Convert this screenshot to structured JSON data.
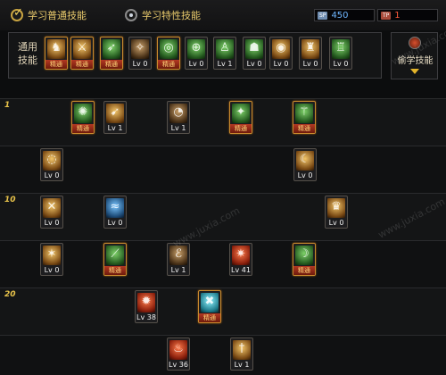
{
  "header": {
    "tabs": [
      {
        "label": "学习普通技能",
        "selected": true
      },
      {
        "label": "学习特性技能",
        "selected": false
      }
    ],
    "counters": [
      {
        "tag": "SP",
        "value": "450",
        "color": "#6fb6ff"
      },
      {
        "tag": "TP",
        "value": "1",
        "color": "#ff5a3c"
      }
    ]
  },
  "common_panel": {
    "label_line1": "通用",
    "label_line2": "技能",
    "skills": [
      {
        "icon": "warrior-stance-icon",
        "badge": "精通",
        "mastered": true,
        "color": "gold"
      },
      {
        "icon": "leap-attack-icon",
        "badge": "精通",
        "mastered": true,
        "color": "gold"
      },
      {
        "icon": "dash-icon",
        "badge": "精通",
        "mastered": true,
        "color": "green"
      },
      {
        "icon": "wings-icon",
        "badge": "Lv 0",
        "mastered": false,
        "color": "dark"
      },
      {
        "icon": "target-icon",
        "badge": "精通",
        "mastered": true,
        "color": "green"
      },
      {
        "icon": "crosshair-icon",
        "badge": "Lv 0",
        "mastered": false,
        "color": "green"
      },
      {
        "icon": "kneel-figure-icon",
        "badge": "Lv 1",
        "mastered": false,
        "color": "green"
      },
      {
        "icon": "rest-figure-icon",
        "badge": "Lv 0",
        "mastered": false,
        "color": "green"
      },
      {
        "icon": "ring-icon",
        "badge": "Lv 0",
        "mastered": false,
        "color": "gold"
      },
      {
        "icon": "strength-figure-icon",
        "badge": "Lv 0",
        "mastered": false,
        "color": "gold"
      },
      {
        "icon": "hero-figure-icon",
        "badge": "Lv 0",
        "mastered": false,
        "color": "green"
      }
    ]
  },
  "learn_button": {
    "label": "偷学技能"
  },
  "tree": {
    "levels": [
      "1",
      "10",
      "20"
    ],
    "skills": [
      {
        "icon": "whirlwind-slash-icon",
        "badge": "精通",
        "mastered": true,
        "color": "green"
      },
      {
        "icon": "flying-kick-icon",
        "badge": "Lv 1",
        "mastered": false,
        "color": "gold"
      },
      {
        "icon": "spiral-strike-icon",
        "badge": "Lv 1",
        "mastered": false,
        "color": "dark"
      },
      {
        "icon": "uppercut-icon",
        "badge": "精通",
        "mastered": true,
        "color": "green"
      },
      {
        "icon": "rising-figure-icon",
        "badge": "精通",
        "mastered": true,
        "color": "green"
      },
      {
        "icon": "vortex-icon",
        "badge": "Lv 0",
        "mastered": false,
        "color": "gold"
      },
      {
        "icon": "crescent-icon",
        "badge": "Lv 0",
        "mastered": false,
        "color": "gold"
      },
      {
        "icon": "claw-icon",
        "badge": "Lv 0",
        "mastered": false,
        "color": "gold"
      },
      {
        "icon": "water-wave-icon",
        "badge": "Lv 0",
        "mastered": false,
        "color": "blue"
      },
      {
        "icon": "totem-icon",
        "badge": "Lv 0",
        "mastered": false,
        "color": "gold"
      },
      {
        "icon": "sword-rain-icon",
        "badge": "Lv 0",
        "mastered": false,
        "color": "gold"
      },
      {
        "icon": "green-blade-icon",
        "badge": "精通",
        "mastered": true,
        "color": "green"
      },
      {
        "icon": "hurricane-icon",
        "badge": "Lv 1",
        "mastered": false,
        "color": "dark"
      },
      {
        "icon": "flame-blade-icon",
        "badge": "Lv 41",
        "mastered": false,
        "color": "red"
      },
      {
        "icon": "crescent-slash-icon",
        "badge": "精通",
        "mastered": true,
        "color": "green"
      },
      {
        "icon": "fire-burst-icon",
        "badge": "Lv 38",
        "mastered": false,
        "color": "red"
      },
      {
        "icon": "ice-cross-icon",
        "badge": "精通",
        "mastered": true,
        "color": "cyan"
      },
      {
        "icon": "flame-column-icon",
        "badge": "Lv 36",
        "mastered": false,
        "color": "red"
      },
      {
        "icon": "gold-blade-icon",
        "badge": "Lv 1",
        "mastered": false,
        "color": "gold"
      }
    ]
  },
  "watermarks": [
    "www.juxia.com",
    "www.juxia.com",
    "www.juxia.com"
  ]
}
